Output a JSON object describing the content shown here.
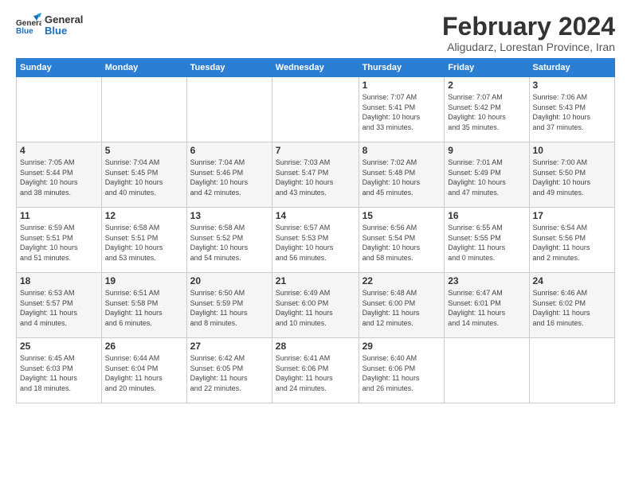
{
  "header": {
    "logo_general": "General",
    "logo_blue": "Blue",
    "title": "February 2024",
    "subtitle": "Aligudarz, Lorestan Province, Iran"
  },
  "weekdays": [
    "Sunday",
    "Monday",
    "Tuesday",
    "Wednesday",
    "Thursday",
    "Friday",
    "Saturday"
  ],
  "weeks": [
    [
      {
        "day": "",
        "info": ""
      },
      {
        "day": "",
        "info": ""
      },
      {
        "day": "",
        "info": ""
      },
      {
        "day": "",
        "info": ""
      },
      {
        "day": "1",
        "info": "Sunrise: 7:07 AM\nSunset: 5:41 PM\nDaylight: 10 hours\nand 33 minutes."
      },
      {
        "day": "2",
        "info": "Sunrise: 7:07 AM\nSunset: 5:42 PM\nDaylight: 10 hours\nand 35 minutes."
      },
      {
        "day": "3",
        "info": "Sunrise: 7:06 AM\nSunset: 5:43 PM\nDaylight: 10 hours\nand 37 minutes."
      }
    ],
    [
      {
        "day": "4",
        "info": "Sunrise: 7:05 AM\nSunset: 5:44 PM\nDaylight: 10 hours\nand 38 minutes."
      },
      {
        "day": "5",
        "info": "Sunrise: 7:04 AM\nSunset: 5:45 PM\nDaylight: 10 hours\nand 40 minutes."
      },
      {
        "day": "6",
        "info": "Sunrise: 7:04 AM\nSunset: 5:46 PM\nDaylight: 10 hours\nand 42 minutes."
      },
      {
        "day": "7",
        "info": "Sunrise: 7:03 AM\nSunset: 5:47 PM\nDaylight: 10 hours\nand 43 minutes."
      },
      {
        "day": "8",
        "info": "Sunrise: 7:02 AM\nSunset: 5:48 PM\nDaylight: 10 hours\nand 45 minutes."
      },
      {
        "day": "9",
        "info": "Sunrise: 7:01 AM\nSunset: 5:49 PM\nDaylight: 10 hours\nand 47 minutes."
      },
      {
        "day": "10",
        "info": "Sunrise: 7:00 AM\nSunset: 5:50 PM\nDaylight: 10 hours\nand 49 minutes."
      }
    ],
    [
      {
        "day": "11",
        "info": "Sunrise: 6:59 AM\nSunset: 5:51 PM\nDaylight: 10 hours\nand 51 minutes."
      },
      {
        "day": "12",
        "info": "Sunrise: 6:58 AM\nSunset: 5:51 PM\nDaylight: 10 hours\nand 53 minutes."
      },
      {
        "day": "13",
        "info": "Sunrise: 6:58 AM\nSunset: 5:52 PM\nDaylight: 10 hours\nand 54 minutes."
      },
      {
        "day": "14",
        "info": "Sunrise: 6:57 AM\nSunset: 5:53 PM\nDaylight: 10 hours\nand 56 minutes."
      },
      {
        "day": "15",
        "info": "Sunrise: 6:56 AM\nSunset: 5:54 PM\nDaylight: 10 hours\nand 58 minutes."
      },
      {
        "day": "16",
        "info": "Sunrise: 6:55 AM\nSunset: 5:55 PM\nDaylight: 11 hours\nand 0 minutes."
      },
      {
        "day": "17",
        "info": "Sunrise: 6:54 AM\nSunset: 5:56 PM\nDaylight: 11 hours\nand 2 minutes."
      }
    ],
    [
      {
        "day": "18",
        "info": "Sunrise: 6:53 AM\nSunset: 5:57 PM\nDaylight: 11 hours\nand 4 minutes."
      },
      {
        "day": "19",
        "info": "Sunrise: 6:51 AM\nSunset: 5:58 PM\nDaylight: 11 hours\nand 6 minutes."
      },
      {
        "day": "20",
        "info": "Sunrise: 6:50 AM\nSunset: 5:59 PM\nDaylight: 11 hours\nand 8 minutes."
      },
      {
        "day": "21",
        "info": "Sunrise: 6:49 AM\nSunset: 6:00 PM\nDaylight: 11 hours\nand 10 minutes."
      },
      {
        "day": "22",
        "info": "Sunrise: 6:48 AM\nSunset: 6:00 PM\nDaylight: 11 hours\nand 12 minutes."
      },
      {
        "day": "23",
        "info": "Sunrise: 6:47 AM\nSunset: 6:01 PM\nDaylight: 11 hours\nand 14 minutes."
      },
      {
        "day": "24",
        "info": "Sunrise: 6:46 AM\nSunset: 6:02 PM\nDaylight: 11 hours\nand 16 minutes."
      }
    ],
    [
      {
        "day": "25",
        "info": "Sunrise: 6:45 AM\nSunset: 6:03 PM\nDaylight: 11 hours\nand 18 minutes."
      },
      {
        "day": "26",
        "info": "Sunrise: 6:44 AM\nSunset: 6:04 PM\nDaylight: 11 hours\nand 20 minutes."
      },
      {
        "day": "27",
        "info": "Sunrise: 6:42 AM\nSunset: 6:05 PM\nDaylight: 11 hours\nand 22 minutes."
      },
      {
        "day": "28",
        "info": "Sunrise: 6:41 AM\nSunset: 6:06 PM\nDaylight: 11 hours\nand 24 minutes."
      },
      {
        "day": "29",
        "info": "Sunrise: 6:40 AM\nSunset: 6:06 PM\nDaylight: 11 hours\nand 26 minutes."
      },
      {
        "day": "",
        "info": ""
      },
      {
        "day": "",
        "info": ""
      }
    ]
  ]
}
